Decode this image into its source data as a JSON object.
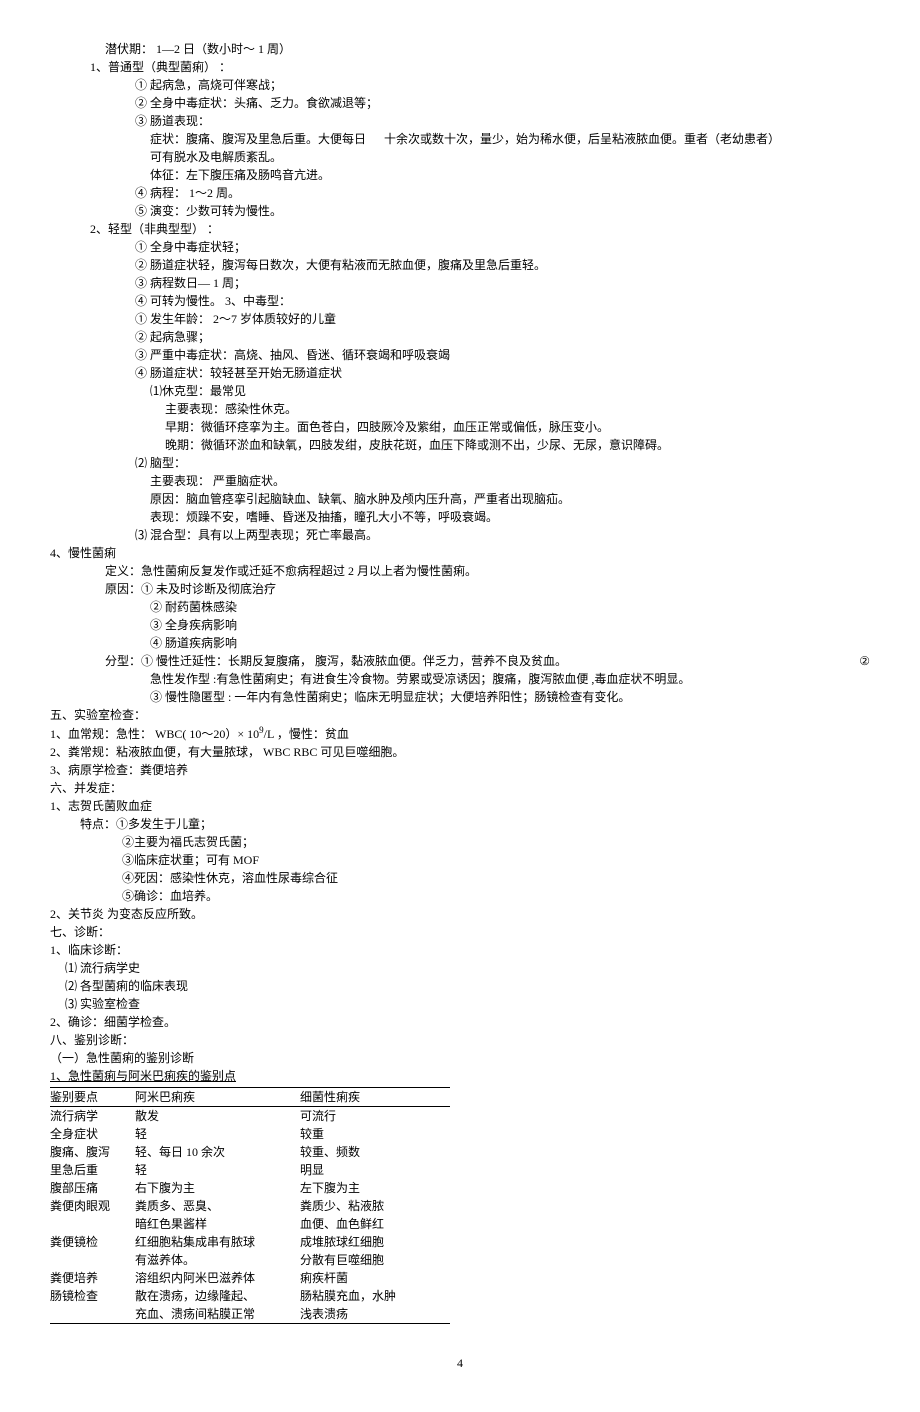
{
  "lines": {
    "l01": "潜伏期：  1—2 日（数小时～  1 周）",
    "l02": "1、普通型（典型菌痢） ：",
    "l03": "①  起病急，高烧可伴寒战；",
    "l04": "②  全身中毒症状：头痛、乏力。食欲减退等；",
    "l05": "③  肠道表现：",
    "l06a": "症状：腹痛、腹泻及里急后重。大便每日",
    "l06b": "十余次或数十次，量少，始为稀水便，后呈粘液脓血便。重者（老幼患者）",
    "l07": "可有脱水及电解质紊乱。",
    "l08": "体征：左下腹压痛及肠鸣音亢进。",
    "l09": "④  病程：  1～2 周。",
    "l10": "⑤  演变：少数可转为慢性。",
    "l11": "2、轻型（非典型型） ：",
    "l12": "①  全身中毒症状轻；",
    "l13": "②  肠道症状轻，腹泻每日数次，大便有粘液而无脓血便，腹痛及里急后重轻。",
    "l14": "③  病程数日— 1 周；",
    "l15": "④  可转为慢性。  3、中毒型：",
    "l16": "①  发生年龄：  2～7 岁体质较好的儿童",
    "l17": "②  起病急骤；",
    "l18": "③  严重中毒症状：高烧、抽风、昏迷、循环衰竭和呼吸衰竭",
    "l19": "④  肠道症状：较轻甚至开始无肠道症状",
    "l20": "⑴休克型：最常见",
    "l21": "主要表现：感染性休克。",
    "l22": "早期：微循环痉挛为主。面色苍白，四肢厥冷及紫绀，血压正常或偏低，脉压变小。",
    "l23": "晚期：微循环淤血和缺氧，四肢发绀，皮肤花斑，血压下降或测不出，少尿、无尿，意识障碍。",
    "l24": "⑵  脑型：",
    "l25": "主要表现：    严重脑症状。",
    "l26": "原因：脑血管痉挛引起脑缺血、缺氧、脑水肿及颅内压升高，严重者出现脑疝。",
    "l27": "表现：烦躁不安，嗜睡、昏迷及抽搐，瞳孔大小不等，呼吸衰竭。",
    "l28": "⑶    混合型：具有以上两型表现；死亡率最高。",
    "l29": "4、慢性菌痢",
    "l30": "定义：急性菌痢反复发作或迁延不愈病程超过      2 月以上者为慢性菌痢。",
    "l31": "原因：①    未及时诊断及彻底治疗",
    "l32": "②  耐药菌株感染",
    "l33": "③  全身疾病影响",
    "l34": "④  肠道疾病影响",
    "l35a": "分型：①  慢性迁延性：长期反复腹痛，  腹泻，黏液脓血便。伴乏力，营养不良及贫血。",
    "l35b": "②",
    "l36": "急性发作型  :有急性菌痢史；有进食生冷食物。劳累或受凉诱因；腹痛，腹泻脓血便        ,毒血症状不明显。",
    "l37": "③  慢性隐匿型  :  一年内有急性菌痢史；临床无明显症状；大便培养阳性；肠镜检查有变化。",
    "l38": "五、实验室检查：",
    "l39a": "1、血常规：急性：    WBC( 10～20）× 10",
    "l39b": "9",
    "l39c": "/L ，慢性：贫血",
    "l40": "2、粪常规：粘液脓血便，有大量脓球，      WBC  RBC  可见巨噬细胞。",
    "l41": "3、病原学检查：粪便培养",
    "l42": "六、并发症：",
    "l43": "1、志贺氏菌败血症",
    "l44": "特点：①多发生于儿童；",
    "l45": "②主要为福氏志贺氏菌；",
    "l46": "③临床症状重；可有    MOF",
    "l47": "④死因：感染性休克，溶血性尿毒综合征",
    "l48": "⑤确诊：血培养。",
    "l49": "2、关节炎    为变态反应所致。",
    "l50": "七、诊断：",
    "l51": "1、临床诊断：",
    "l52": "⑴  流行病学史",
    "l53": "⑵  各型菌痢的临床表现",
    "l54": "⑶  实验室检查",
    "l55": "2、确诊：细菌学检查。",
    "l56": "八、鉴别诊断：",
    "l57": "（一）急性菌痢的鉴别诊断",
    "l58": "1、急性菌痢与阿米巴痢疾的鉴别点"
  },
  "table": {
    "headers": [
      "鉴别要点",
      "阿米巴痢疾",
      "细菌性痢疾"
    ],
    "rows": [
      [
        "流行病学",
        "散发",
        "可流行"
      ],
      [
        "全身症状",
        "轻",
        "较重"
      ],
      [
        "腹痛、腹泻",
        "轻、每日  10 余次",
        "较重、频数"
      ],
      [
        "里急后重",
        "轻",
        "明显"
      ],
      [
        "腹部压痛",
        "右下腹为主",
        "左下腹为主"
      ],
      [
        "粪便肉眼观",
        "粪质多、恶臭、\n暗红色果酱样",
        "粪质少、粘液脓\n血便、血色鲜红"
      ],
      [
        "粪便镜检",
        "红细胞粘集成串有脓球\n有滋养体。",
        "成堆脓球红细胞\n分散有巨噬细胞"
      ],
      [
        "粪便培养",
        "溶组织内阿米巴滋养体",
        "痢疾杆菌"
      ],
      [
        "肠镜检查",
        "散在溃疡，边缘隆起、\n充血、溃疡间粘膜正常",
        "肠粘膜充血，水肿\n浅表溃疡"
      ]
    ]
  },
  "pagenum": "4"
}
